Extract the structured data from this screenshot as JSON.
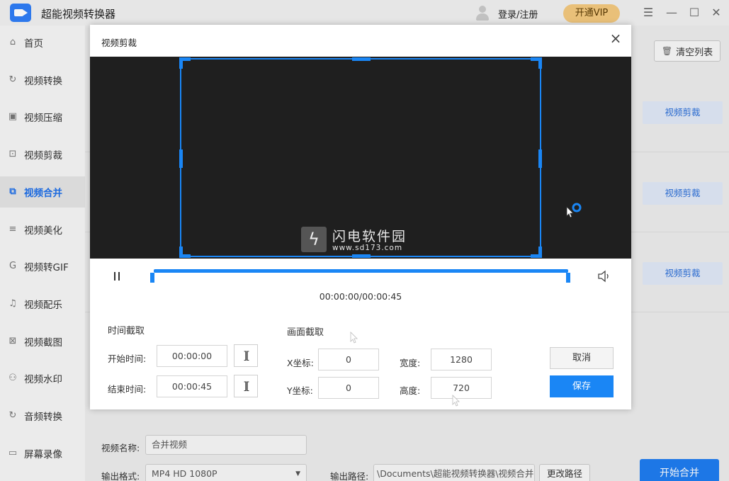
{
  "app": {
    "title": "超能视频转换器",
    "login_label": "登录/注册",
    "vip_label": "开通VIP"
  },
  "sidebar": {
    "items": [
      {
        "label": "首页",
        "icon": "home-icon",
        "glyph": "⌂"
      },
      {
        "label": "视频转换",
        "icon": "convert-icon",
        "glyph": "↻"
      },
      {
        "label": "视频压缩",
        "icon": "compress-icon",
        "glyph": "▣"
      },
      {
        "label": "视频剪裁",
        "icon": "crop-icon",
        "glyph": "⊡"
      },
      {
        "label": "视频合并",
        "icon": "merge-icon",
        "glyph": "⧉",
        "active": true
      },
      {
        "label": "视频美化",
        "icon": "beautify-icon",
        "glyph": "≡"
      },
      {
        "label": "视频转GIF",
        "icon": "gif-icon",
        "glyph": "G"
      },
      {
        "label": "视频配乐",
        "icon": "music-icon",
        "glyph": "♫"
      },
      {
        "label": "视频截图",
        "icon": "screenshot-icon",
        "glyph": "⊠"
      },
      {
        "label": "视频水印",
        "icon": "watermark-icon",
        "glyph": "⚇"
      },
      {
        "label": "音频转换",
        "icon": "audio-icon",
        "glyph": "↻"
      },
      {
        "label": "屏幕录像",
        "icon": "record-icon",
        "glyph": "▭"
      }
    ]
  },
  "main": {
    "clear_list_label": "清空列表",
    "crop_button_label": "视频剪裁",
    "video_name_label": "视频名称:",
    "video_name_value": "合并视频",
    "output_format_label": "输出格式:",
    "output_format_value": "MP4 HD 1080P",
    "output_path_label": "输出路径:",
    "output_path_value": "\\Documents\\超能视频转换器\\视频合并",
    "change_path_label": "更改路径",
    "start_merge_label": "开始合并"
  },
  "dialog": {
    "title": "视频剪裁",
    "time_readout": "00:00:00/00:00:45",
    "time_section_title": "时间截取",
    "start_time_label": "开始时间:",
    "start_time_value": "00:00:00",
    "end_time_label": "结束时间:",
    "end_time_value": "00:00:45",
    "set_time_glyph": "][",
    "frame_section_title": "画面截取",
    "x_label": "X坐标:",
    "x_value": "0",
    "y_label": "Y坐标:",
    "y_value": "0",
    "width_label": "宽度:",
    "width_value": "1280",
    "height_label": "高度:",
    "height_value": "720",
    "cancel_label": "取消",
    "save_label": "保存",
    "watermark_name": "闪电软件园",
    "watermark_url": "www.sd173.com",
    "accent_color": "#1a86f5"
  }
}
